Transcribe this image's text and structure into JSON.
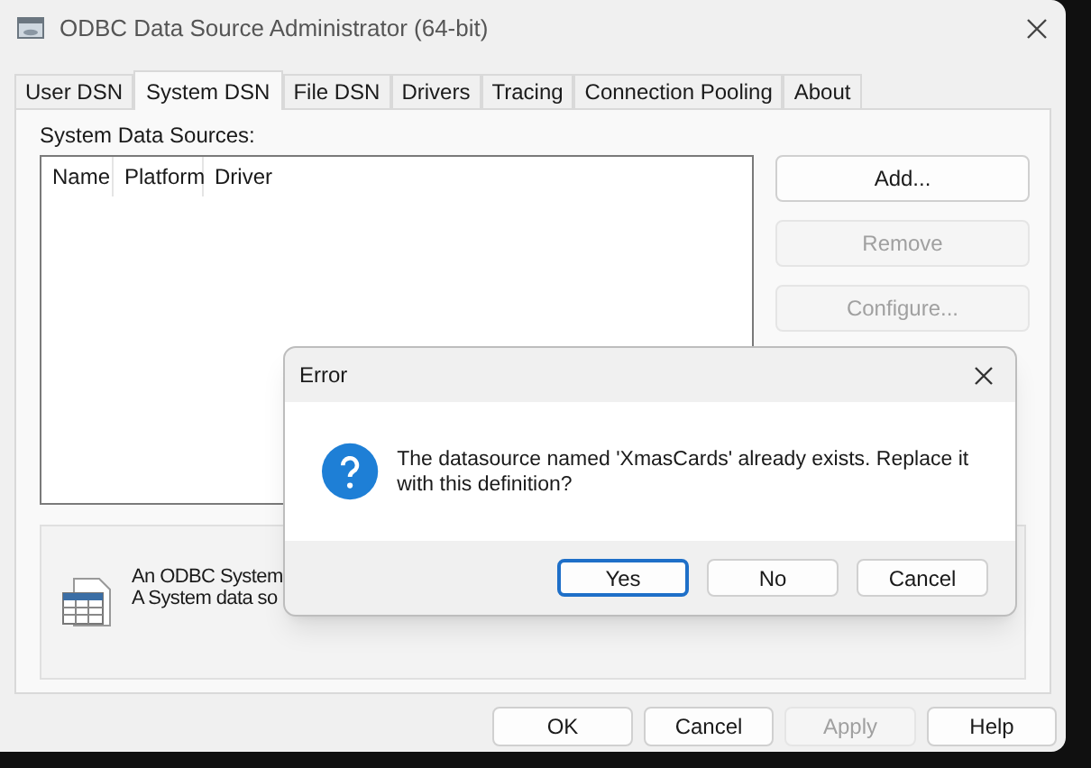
{
  "window": {
    "title": "ODBC Data Source Administrator (64-bit)"
  },
  "tabs": [
    {
      "label": "User DSN",
      "selected": false
    },
    {
      "label": "System DSN",
      "selected": true
    },
    {
      "label": "File DSN",
      "selected": false
    },
    {
      "label": "Drivers",
      "selected": false
    },
    {
      "label": "Tracing",
      "selected": false
    },
    {
      "label": "Connection Pooling",
      "selected": false
    },
    {
      "label": "About",
      "selected": false
    }
  ],
  "list_label": "System Data Sources:",
  "table": {
    "columns": [
      "Name",
      "Platform",
      "Driver"
    ]
  },
  "side_buttons": [
    {
      "label": "Add...",
      "disabled": false
    },
    {
      "label": "Remove",
      "disabled": true
    },
    {
      "label": "Configure...",
      "disabled": true
    }
  ],
  "description": [
    "An ODBC System",
    "A System data so"
  ],
  "footer_buttons": [
    {
      "label": "OK",
      "disabled": false
    },
    {
      "label": "Cancel",
      "disabled": false
    },
    {
      "label": "Apply",
      "disabled": true
    },
    {
      "label": "Help",
      "disabled": false
    }
  ],
  "dialog": {
    "title": "Error",
    "message": "The datasource named 'XmasCards' already exists.  Replace it with this definition?",
    "buttons": [
      {
        "label": "Yes",
        "selected": true
      },
      {
        "label": "No",
        "selected": false
      },
      {
        "label": "Cancel",
        "selected": false
      }
    ]
  }
}
